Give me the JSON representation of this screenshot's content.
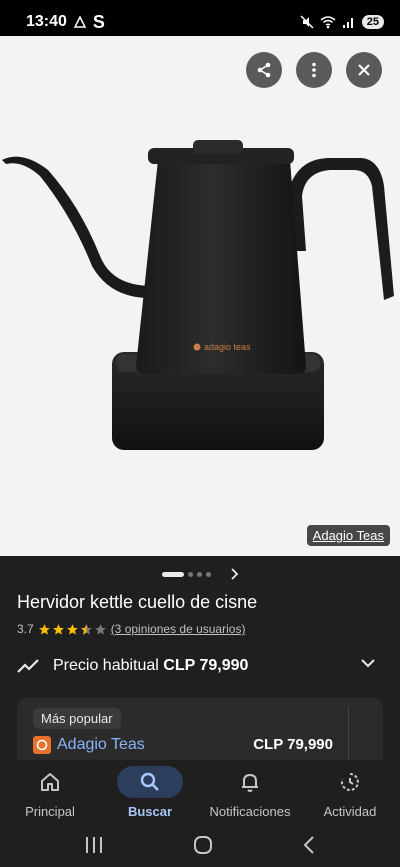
{
  "status": {
    "time": "13:40",
    "battery": "25"
  },
  "image": {
    "source_label": "Adagio Teas",
    "kettle_brand": "adagio teas"
  },
  "product": {
    "title": "Hervidor kettle cuello de cisne",
    "rating": "3.7",
    "rating_value": 3.7,
    "reviews_link": "(3 opiniones de usuarios)"
  },
  "price": {
    "label": "Precio habitual",
    "value": "CLP 79,990"
  },
  "offer": {
    "badge": "Más popular",
    "store": "Adagio Teas",
    "price": "CLP 79,990"
  },
  "nav": {
    "items": [
      {
        "label": "Principal",
        "icon": "home-icon"
      },
      {
        "label": "Buscar",
        "icon": "search-icon"
      },
      {
        "label": "Notificaciones",
        "icon": "bell-icon"
      },
      {
        "label": "Actividad",
        "icon": "activity-icon"
      }
    ]
  },
  "colors": {
    "accent": "#a8c7fa",
    "link": "#8ab4f8",
    "star": "#fbbc04"
  }
}
